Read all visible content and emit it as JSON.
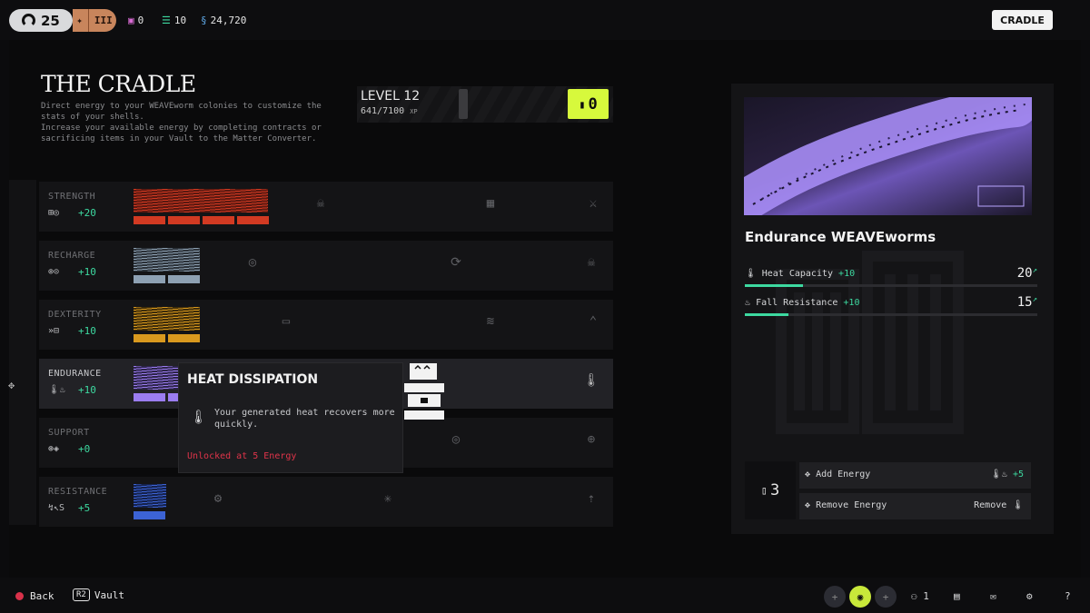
{
  "topbar": {
    "level": "25",
    "rank_numeral": "III",
    "stats": [
      {
        "icon": "cube-icon",
        "value": "0"
      },
      {
        "icon": "stack-icon",
        "value": "10"
      },
      {
        "icon": "currency-icon",
        "value": "24,720"
      }
    ],
    "cradle_button": "CRADLE"
  },
  "page": {
    "title": "THE CRADLE",
    "description": "Direct energy to your WEAVEworm colonies to customize the stats of your shells.\nIncrease your available energy by completing contracts or sacrificing items in your Vault to the Matter Converter."
  },
  "level": {
    "label": "LEVEL 12",
    "xp": "641/7100",
    "xp_unit": "XP",
    "energy": "0"
  },
  "rows": [
    {
      "name": "STRENGTH",
      "value": "+20",
      "icons": "⊞◎",
      "color": "#d23a22"
    },
    {
      "name": "RECHARGE",
      "value": "+10",
      "icons": "⊚⊙",
      "color": "#8ea1b3"
    },
    {
      "name": "DEXTERITY",
      "value": "+10",
      "icons": "»⊟",
      "color": "#d9991e"
    },
    {
      "name": "ENDURANCE",
      "value": "+10",
      "icons": "🌡♨",
      "color": "#9b7df0"
    },
    {
      "name": "SUPPORT",
      "value": "+0",
      "icons": "⊛◈",
      "color": "#444"
    },
    {
      "name": "RESISTANCE",
      "value": "+5",
      "icons": "↯↖S",
      "color": "#3c63d4"
    }
  ],
  "tooltip": {
    "title": "HEAT DISSIPATION",
    "description": "Your generated heat recovers more quickly.",
    "unlock": "Unlocked at 5 Energy"
  },
  "detail": {
    "name": "Endurance WEAVEworms",
    "attributes": [
      {
        "label": "Heat Capacity",
        "bonus": "+10",
        "value": "20",
        "fill": 0.2
      },
      {
        "label": "Fall Resistance",
        "bonus": "+10",
        "value": "15",
        "fill": 0.15
      }
    ],
    "energy_count": "3",
    "add_label": "Add Energy",
    "add_bonus": "+5",
    "remove_label": "Remove Energy",
    "remove_right": "Remove"
  },
  "bottombar": {
    "back": "Back",
    "vault_key": "R2",
    "vault": "Vault",
    "squad_count": "1"
  }
}
